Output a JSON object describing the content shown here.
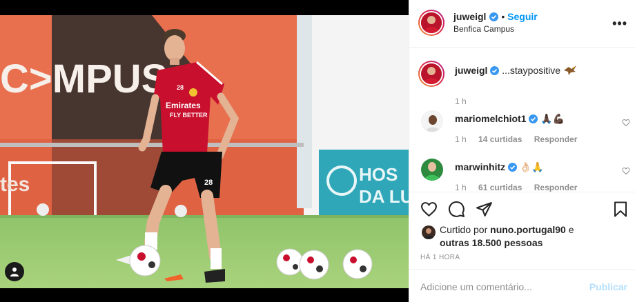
{
  "post": {
    "username": "juweigl",
    "follow_label": "Seguir",
    "location": "Benfica Campus",
    "caption": "...staypositive",
    "caption_time": "1 h"
  },
  "photo": {
    "wall_text": "C>MPUS",
    "shirt_number": "28",
    "sponsor_line1": "Emirates",
    "sponsor_line2": "FLY BETTER",
    "banner_text": "HOS",
    "banner_text2": "DA LU",
    "fence_text": "tes"
  },
  "comments": [
    {
      "username": "mariomelchiot1",
      "text": "🙏🏿💪🏿",
      "time": "1 h",
      "likes": "14 curtidas",
      "reply": "Responder"
    },
    {
      "username": "marwinhitz",
      "text": "👌🏻🙏",
      "time": "1 h",
      "likes": "61 curtidas",
      "reply": "Responder"
    }
  ],
  "liked_by": {
    "prefix": "Curtido por",
    "user": "nuno.portugal90",
    "conj": "e",
    "others": "outras 18.500 pessoas"
  },
  "timestamp": "HÁ 1 HORA",
  "add_comment": {
    "placeholder": "Adicione um comentário...",
    "publish": "Publicar"
  },
  "colors": {
    "accent": "#0095f6",
    "publish_disabled": "#b2dffc",
    "verified": "#3897f0"
  },
  "icons": [
    "user-tag-icon",
    "more-options-icon",
    "verified-icon",
    "heart-icon",
    "comment-icon",
    "share-icon",
    "bookmark-icon"
  ]
}
